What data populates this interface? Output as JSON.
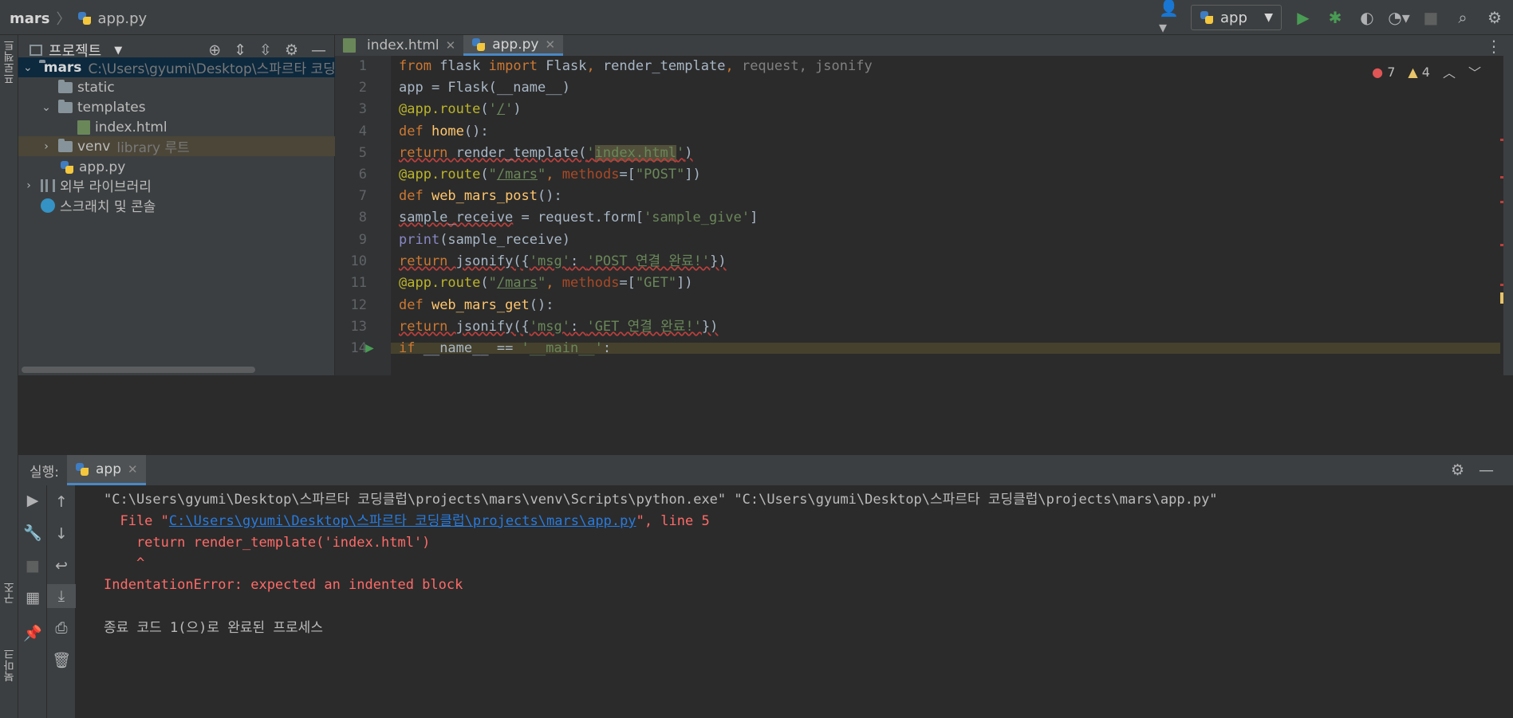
{
  "breadcrumb": {
    "project": "mars",
    "file": "app.py"
  },
  "toolbar": {
    "run_config": "app"
  },
  "project_panel": {
    "title": "프로젝트",
    "tree": [
      {
        "label": "mars",
        "extra": "C:\\Users\\gyumi\\Desktop\\스파르타 코딩클",
        "type": "folder",
        "expanded": true
      },
      {
        "label": "static",
        "type": "folder"
      },
      {
        "label": "templates",
        "type": "folder",
        "expanded": true
      },
      {
        "label": "index.html",
        "type": "html"
      },
      {
        "label": "venv",
        "extra": "library 루트",
        "type": "folder"
      },
      {
        "label": "app.py",
        "type": "python"
      },
      {
        "label": "외부 라이브러리",
        "type": "library"
      },
      {
        "label": "스크래치 및 콘솔",
        "type": "scratch"
      }
    ]
  },
  "side_tabs": {
    "left_top": "프로젝트",
    "left_mid": "구조",
    "left_bottom": "북마크"
  },
  "editor": {
    "tabs": [
      {
        "label": "index.html",
        "active": false
      },
      {
        "label": "app.py",
        "active": true
      }
    ],
    "inspection": {
      "errors": "7",
      "warnings": "4"
    },
    "line_numbers": [
      "1",
      "2",
      "3",
      "4",
      "5",
      "6",
      "7",
      "8",
      "9",
      "10",
      "11",
      "12",
      "13",
      "14"
    ],
    "lines": [
      "from flask import Flask, render_template, request, jsonify",
      "app = Flask(__name__)",
      "@app.route('/')",
      "def home():",
      "return render_template('index.html')",
      "@app.route(\"/mars\", methods=[\"POST\"])",
      "def web_mars_post():",
      "sample_receive = request.form['sample_give']",
      "print(sample_receive)",
      "return jsonify({'msg': 'POST 연결 완료!'})",
      "@app.route(\"/mars\", methods=[\"GET\"])",
      "def web_mars_get():",
      "return jsonify({'msg': 'GET 연결 완료!'})",
      "if __name__ == '__main__':"
    ]
  },
  "run_panel": {
    "label": "실행:",
    "tab": "app",
    "console": {
      "cmd": "\"C:\\Users\\gyumi\\Desktop\\스파르타 코딩클럽\\projects\\mars\\venv\\Scripts\\python.exe\" \"C:\\Users\\gyumi\\Desktop\\스파르타 코딩클럽\\projects\\mars\\app.py\"",
      "file_prefix": "  File \"",
      "file_link": "C:\\Users\\gyumi\\Desktop\\스파르타 코딩클럽\\projects\\mars\\app.py",
      "file_suffix": "\", line 5",
      "code_line": "    return render_template('index.html')",
      "caret": "    ^",
      "error": "IndentationError: expected an indented block",
      "exit": "종료 코드 1(으)로 완료된 프로세스"
    }
  }
}
